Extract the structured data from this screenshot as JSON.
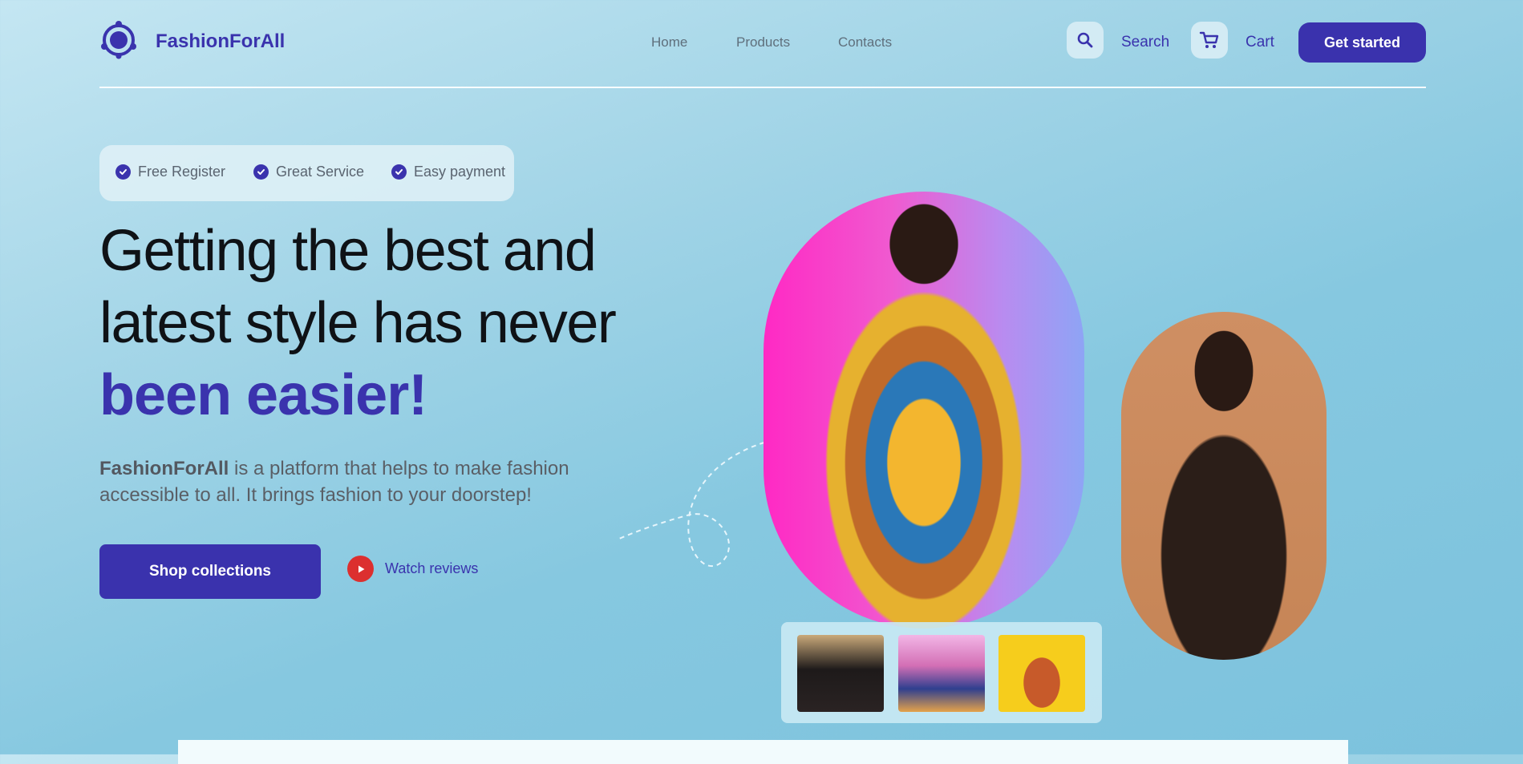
{
  "header": {
    "brand": "FashionForAll",
    "nav": [
      "Home",
      "Products",
      "Contacts"
    ],
    "search_label": "Search",
    "cart_label": "Cart",
    "cta_label": "Get started"
  },
  "hero": {
    "features": [
      "Free Register",
      "Great Service",
      "Easy payment"
    ],
    "headline_line1": "Getting the best and",
    "headline_line2": "latest style has never",
    "headline_line3": "been easier!",
    "description_brand": "FashionForAll",
    "description_rest": " is a platform that helps to make fashion accessible to all. It brings fashion to your doorstep!",
    "shop_label": "Shop collections",
    "watch_label": "Watch reviews"
  },
  "colors": {
    "brand_primary": "#3a33ad",
    "play_red": "#dc2f2f"
  },
  "icons": {
    "logo": "logo-icon",
    "search": "search-icon",
    "cart": "cart-icon",
    "check": "check-icon",
    "play": "play-icon"
  }
}
